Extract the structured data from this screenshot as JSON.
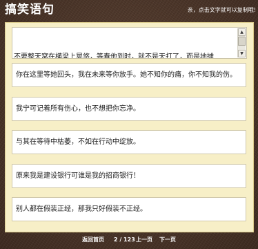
{
  "header": {
    "title": "搞笑语句",
    "hint": "亲，点击文字就可以复制哦!"
  },
  "first_item": {
    "text": "不要整天窝在横梁上晃悠，等春他到时，就不是天打了，而是地摊"
  },
  "quotes": [
    "你在这里等她回头，我在未来等你放手。她不知你的痛，你不知我的伤。",
    "我宁可记着所有伤心，也不想把你忘净。",
    "与其在等待中枯萎，不如在行动中绽放。",
    "原来我是建设银行可谁是我的招商银行！",
    "别人都在假装正经，那我只好假装不正经。"
  ],
  "footer": {
    "home_label": "返回首页",
    "page_indicator": "2 / 123",
    "prev_label": "上一页",
    "next_label": "下一页"
  }
}
